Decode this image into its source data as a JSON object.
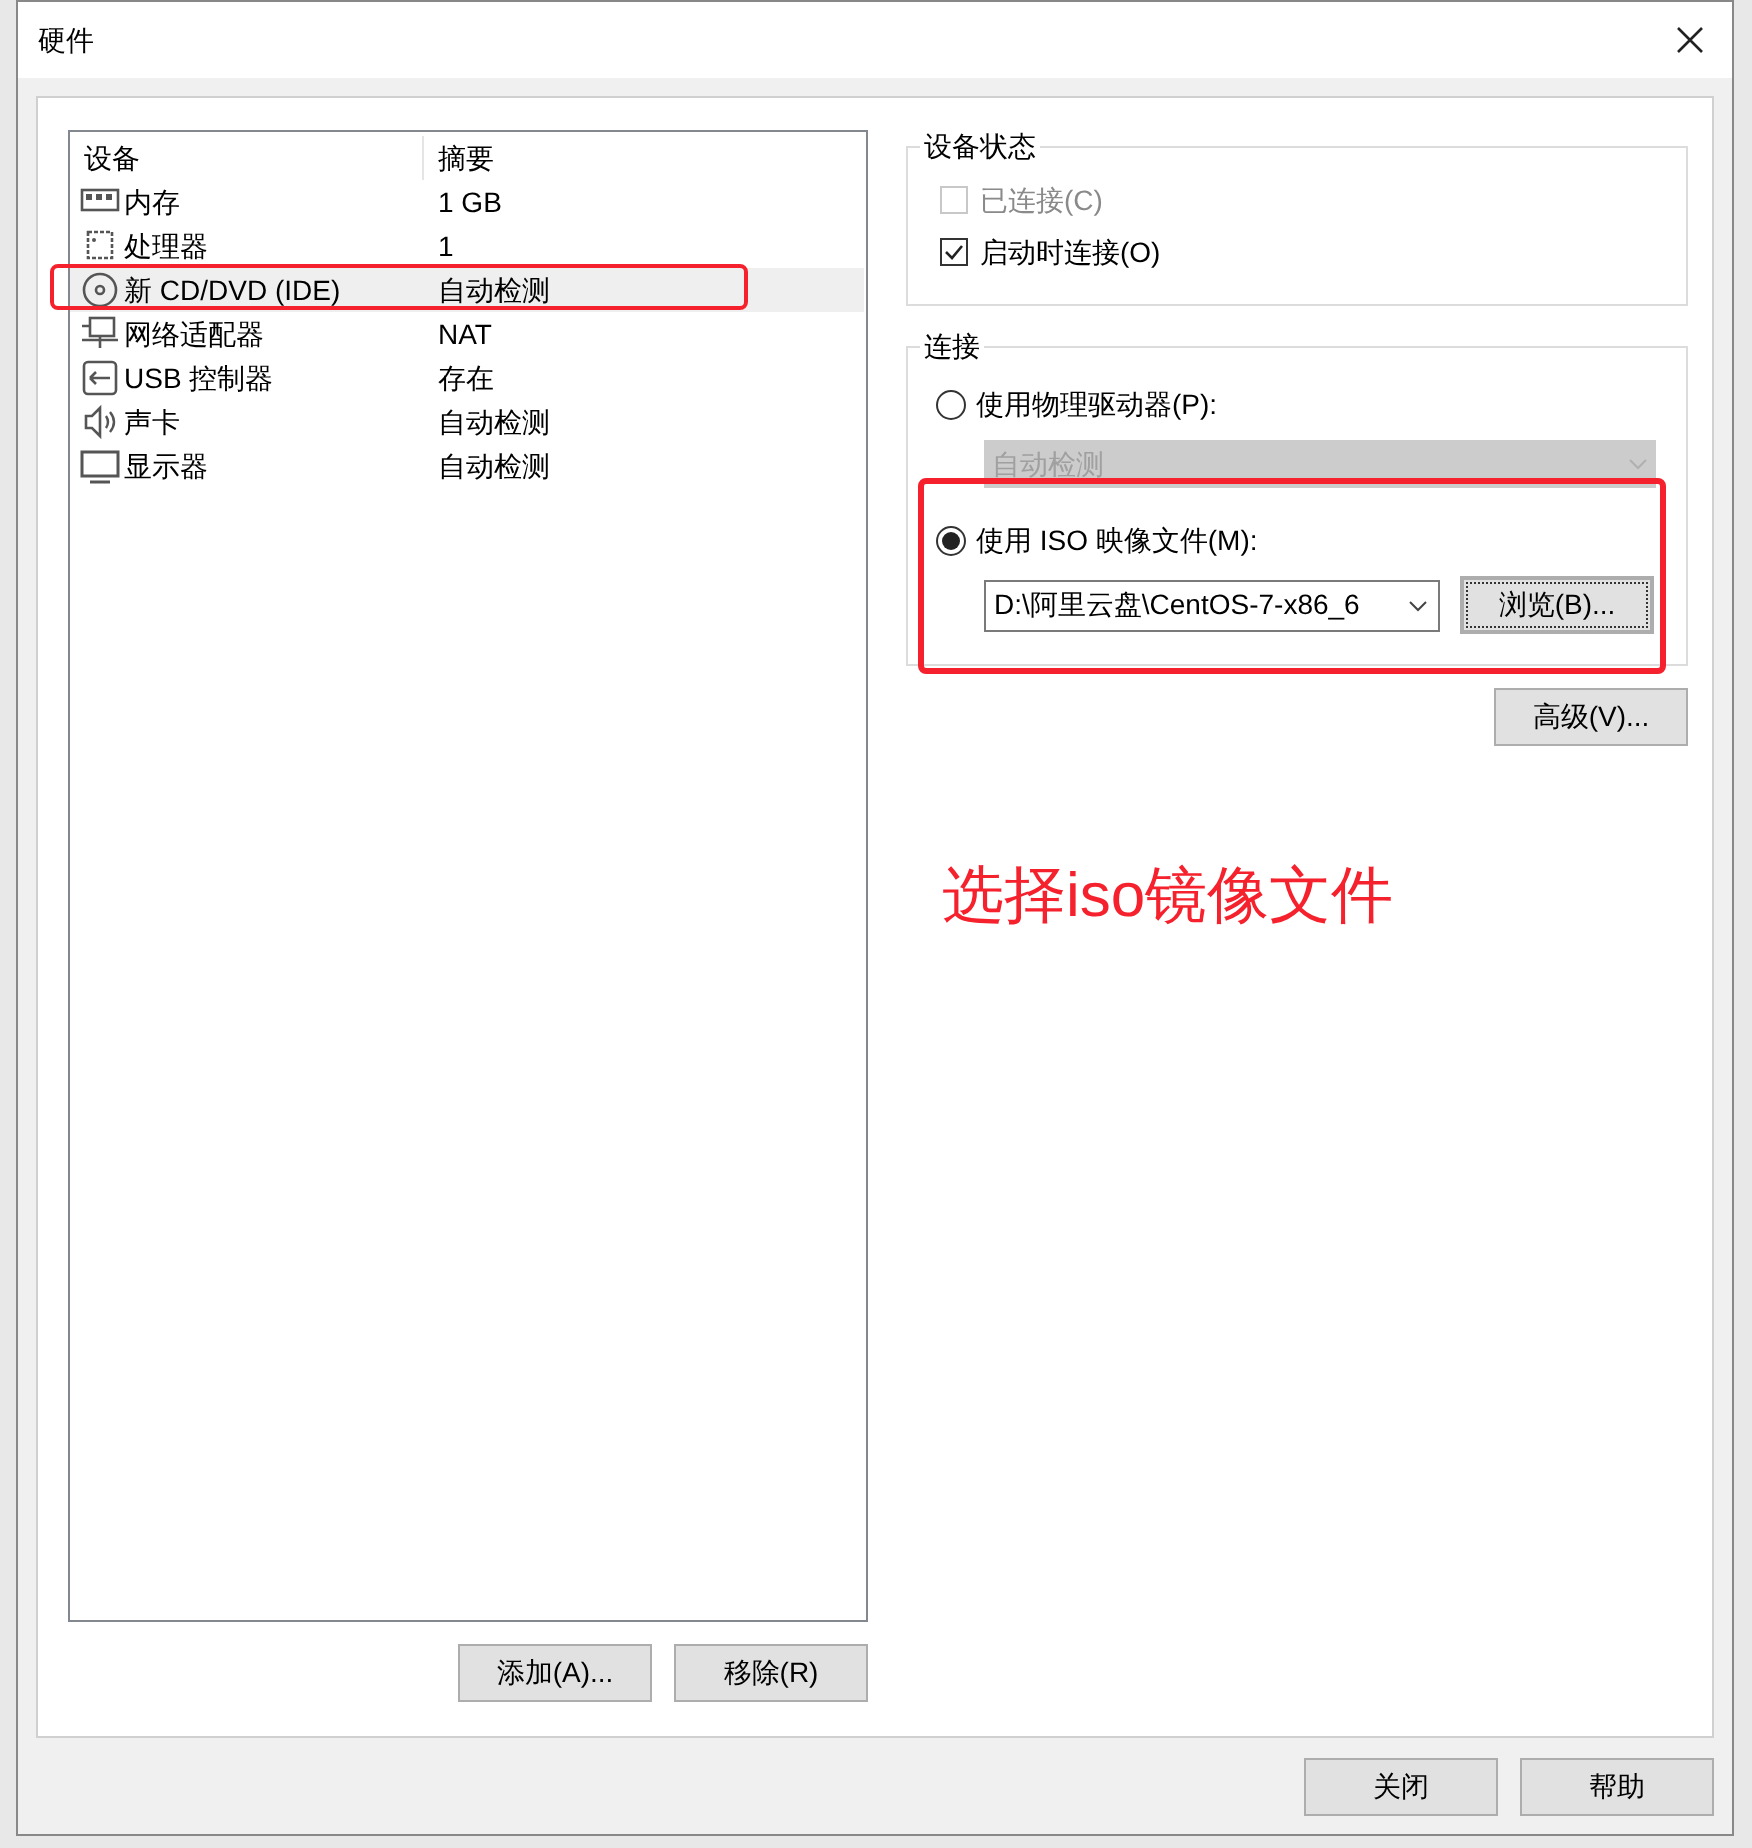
{
  "window": {
    "title": "硬件"
  },
  "devices": {
    "columns": [
      "设备",
      "摘要"
    ],
    "rows": [
      {
        "kind": "memory",
        "name": "内存",
        "summary": "1 GB",
        "selected": false
      },
      {
        "kind": "cpu",
        "name": "处理器",
        "summary": "1",
        "selected": false
      },
      {
        "kind": "cd",
        "name": "新 CD/DVD (IDE)",
        "summary": "自动检测",
        "selected": true
      },
      {
        "kind": "network",
        "name": "网络适配器",
        "summary": "NAT",
        "selected": false
      },
      {
        "kind": "usb",
        "name": "USB 控制器",
        "summary": "存在",
        "selected": false
      },
      {
        "kind": "sound",
        "name": "声卡",
        "summary": "自动检测",
        "selected": false
      },
      {
        "kind": "display",
        "name": "显示器",
        "summary": "自动检测",
        "selected": false
      }
    ]
  },
  "list_buttons": [
    "添加(A)...",
    "移除(R)"
  ],
  "device_status": {
    "title": "设备状态",
    "options": [
      {
        "label": "已连接(C)",
        "checked": false,
        "disabled": true
      },
      {
        "label": "启动时连接(O)",
        "checked": true,
        "disabled": false
      }
    ]
  },
  "connection": {
    "title": "连接",
    "physical": {
      "label": "使用物理驱动器(P):",
      "selected": false,
      "value": "自动检测",
      "disabled": true
    },
    "iso": {
      "label": "使用 ISO 映像文件(M):",
      "selected": true,
      "value": "D:\\阿里云盘\\CentOS-7-x86_6",
      "browse": "浏览(B)..."
    }
  },
  "advanced_button": "高级(V)...",
  "annotation": {
    "text": "选择iso镜像文件"
  },
  "footer_buttons": [
    "关闭",
    "帮助"
  ]
}
